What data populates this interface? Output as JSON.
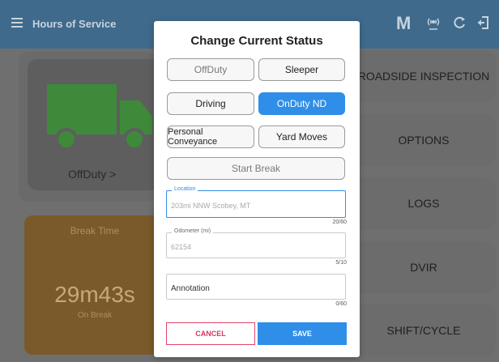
{
  "appbar": {
    "title": "Hours of Service",
    "m_letter": "M",
    "icons": [
      "menu-icon",
      "antenna-icon",
      "refresh-icon",
      "logout-icon"
    ]
  },
  "dashboard": {
    "status_label": "OffDuty  >",
    "break_title": "Break Time",
    "break_time": "29m43s",
    "break_sub": "On Break",
    "buttons": [
      "ROADSIDE INSPECTION",
      "OPTIONS",
      "LOGS",
      "DVIR",
      "SHIFT/CYCLE"
    ]
  },
  "modal": {
    "title": "Change Current Status",
    "statuses": {
      "offduty": "OffDuty",
      "sleeper": "Sleeper",
      "driving": "Driving",
      "onduty": "OnDuty ND",
      "personal": "Personal Conveyance",
      "yard": "Yard Moves",
      "start_break": "Start Break"
    },
    "selected": "OnDuty ND",
    "location": {
      "label": "Location",
      "value": "203mi NNW Scobey, MT",
      "counter": "20/60"
    },
    "odometer": {
      "label": "Odometer (mi)",
      "value": "62154",
      "counter": "5/10"
    },
    "annotation": {
      "label": "Annotation",
      "counter": "0/60"
    },
    "cancel_label": "CANCEL",
    "save_label": "SAVE"
  },
  "colors": {
    "appbar": "#3f6a8c",
    "accent_blue": "#2f8ee8",
    "cancel_red": "#d13b5f",
    "truck_green": "#3e8a3a",
    "break_orange": "#7a5a2a"
  }
}
